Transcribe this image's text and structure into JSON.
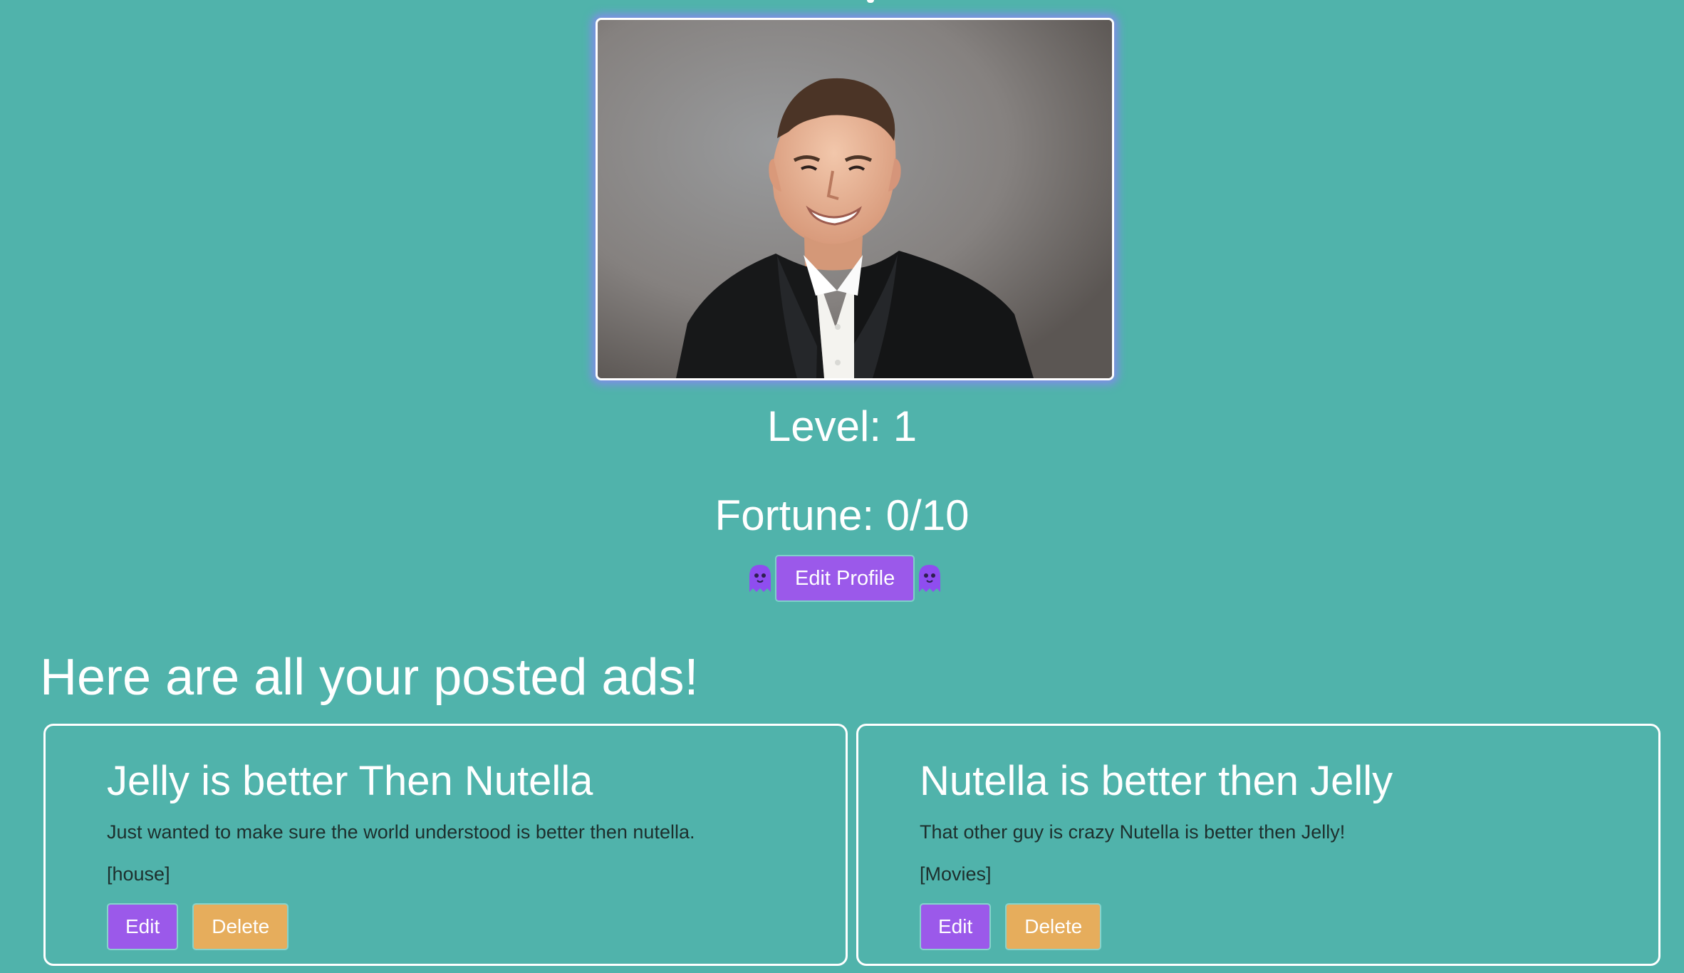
{
  "profile": {
    "level_text": "Level: 1",
    "fortune_text": "Fortune: 0/10",
    "edit_profile_label": "Edit Profile",
    "photo_alt": "Profile photo",
    "ghost_icon": "ghost-icon"
  },
  "ads": {
    "heading": "Here are all your posted ads!",
    "items": [
      {
        "title": "Jelly is better Then Nutella",
        "description": "Just wanted to make sure the world understood is better then nutella.",
        "category": "[house]",
        "edit_label": "Edit",
        "delete_label": "Delete"
      },
      {
        "title": "Nutella is better then Jelly",
        "description": "That other guy is crazy Nutella is better then Jelly!",
        "category": "[Movies]",
        "edit_label": "Edit",
        "delete_label": "Delete"
      }
    ]
  },
  "colors": {
    "background": "#50b3ab",
    "accent_purple": "#9b59ea",
    "accent_orange": "#e6ad5c",
    "photo_glow": "#7f8ee6",
    "text_white": "#ffffff",
    "text_dark": "#1d2f2d"
  }
}
